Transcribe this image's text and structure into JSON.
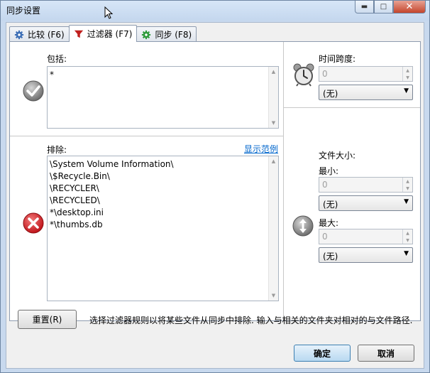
{
  "window": {
    "title": "同步设置",
    "min": "▬",
    "max": "□",
    "close": "✕"
  },
  "tabs": [
    {
      "label": "比较 (F6)",
      "icon": "gear-icon"
    },
    {
      "label": "过滤器 (F7)",
      "icon": "funnel-icon",
      "active": true
    },
    {
      "label": "同步 (F8)",
      "icon": "gear-green-icon"
    }
  ],
  "include": {
    "label": "包括:",
    "lines": [
      "*"
    ]
  },
  "exclude": {
    "label": "排除:",
    "link": "显示范例",
    "lines": [
      "\\System Volume Information\\",
      "\\$Recycle.Bin\\",
      "\\RECYCLER\\",
      "\\RECYCLED\\",
      "*\\desktop.ini",
      "*\\thumbs.db"
    ]
  },
  "time_span": {
    "label": "时间跨度:",
    "value": "0",
    "unit": "(无)"
  },
  "file_size": {
    "label": "文件大小:",
    "min_label": "最小:",
    "min_value": "0",
    "min_unit": "(无)",
    "max_label": "最大:",
    "max_value": "0",
    "max_unit": "(无)"
  },
  "footer": {
    "reset_label": "重置(R)",
    "hint": "选择过滤器规则以将某些文件从同步中排除. 输入与相关的文件夹对相对的与文件路径.",
    "ok_label": "确定",
    "cancel_label": "取消"
  },
  "colors": {
    "accent": "#0066cc",
    "error": "#d9262c",
    "check": "#7a7a7a"
  }
}
